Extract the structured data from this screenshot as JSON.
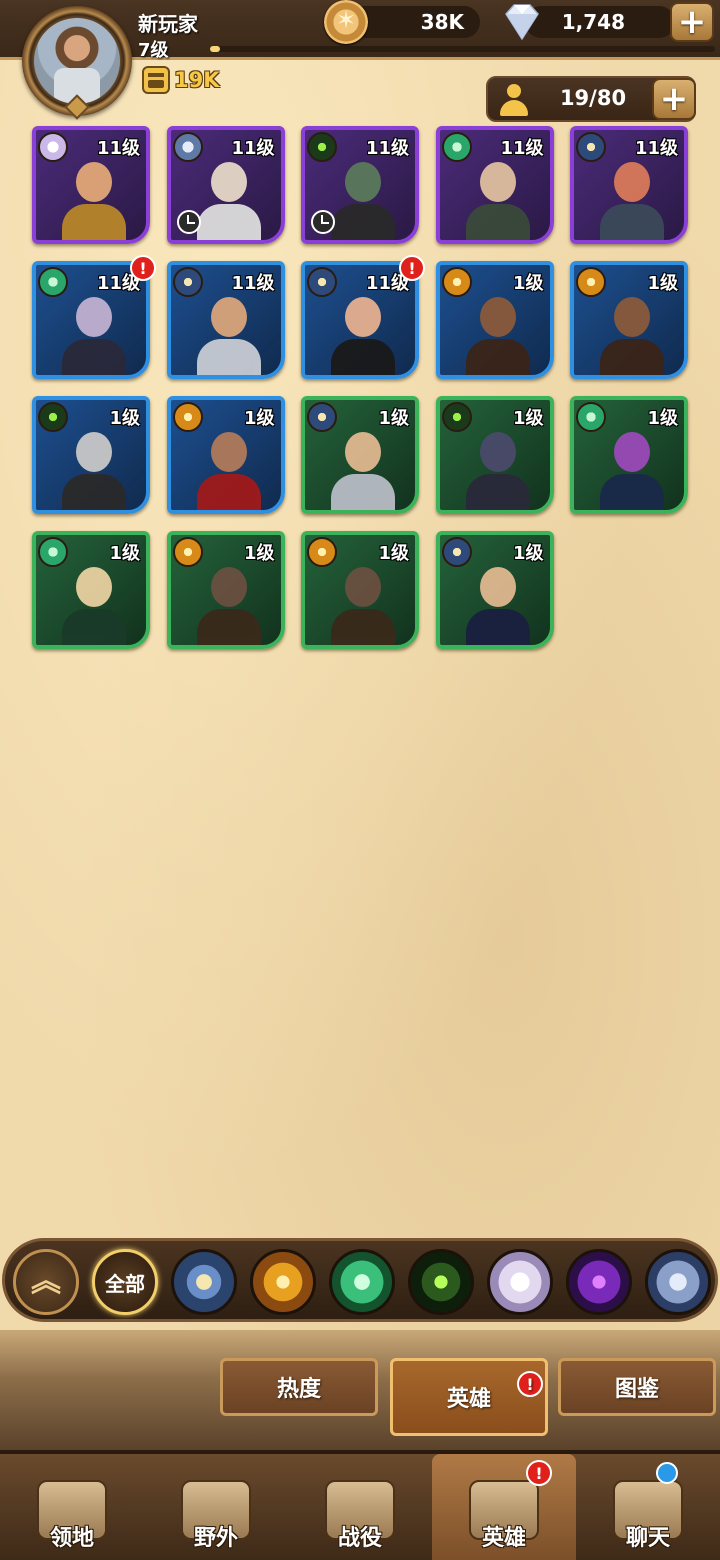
{
  "player": {
    "name": "新玩家",
    "level": "7级",
    "xp_progress": 0.02,
    "power": "19K"
  },
  "currency": {
    "gold": "38K",
    "gems": "1,748",
    "plus": "+"
  },
  "hero_count": {
    "text": "19/80",
    "plus": "+"
  },
  "heroes": [
    {
      "level": "11级",
      "rarity": "purple",
      "faction": "light",
      "clock": false,
      "alert": false
    },
    {
      "level": "11级",
      "rarity": "purple",
      "faction": "mech",
      "clock": true,
      "alert": false
    },
    {
      "level": "11级",
      "rarity": "purple",
      "faction": "eye",
      "clock": true,
      "alert": false
    },
    {
      "level": "11级",
      "rarity": "purple",
      "faction": "leaf",
      "clock": false,
      "alert": false
    },
    {
      "level": "11级",
      "rarity": "purple",
      "faction": "star",
      "clock": false,
      "alert": false
    },
    {
      "level": "11级",
      "rarity": "blue",
      "faction": "leaf",
      "clock": false,
      "alert": true
    },
    {
      "level": "11级",
      "rarity": "blue",
      "faction": "star",
      "clock": false,
      "alert": false
    },
    {
      "level": "11级",
      "rarity": "blue",
      "faction": "star",
      "clock": false,
      "alert": true
    },
    {
      "level": "1级",
      "rarity": "blue",
      "faction": "sun",
      "clock": false,
      "alert": false
    },
    {
      "level": "1级",
      "rarity": "blue",
      "faction": "sun",
      "clock": false,
      "alert": false
    },
    {
      "level": "1级",
      "rarity": "blue",
      "faction": "eye",
      "clock": false,
      "alert": false
    },
    {
      "level": "1级",
      "rarity": "blue",
      "faction": "sun",
      "clock": false,
      "alert": false
    },
    {
      "level": "1级",
      "rarity": "green",
      "faction": "star",
      "clock": false,
      "alert": false
    },
    {
      "level": "1级",
      "rarity": "green",
      "faction": "eye",
      "clock": false,
      "alert": false
    },
    {
      "level": "1级",
      "rarity": "green",
      "faction": "leaf",
      "clock": false,
      "alert": false
    },
    {
      "level": "1级",
      "rarity": "green",
      "faction": "leaf",
      "clock": false,
      "alert": false
    },
    {
      "level": "1级",
      "rarity": "green",
      "faction": "sun",
      "clock": false,
      "alert": false
    },
    {
      "level": "1级",
      "rarity": "green",
      "faction": "sun",
      "clock": false,
      "alert": false
    },
    {
      "level": "1级",
      "rarity": "green",
      "faction": "star",
      "clock": false,
      "alert": false
    }
  ],
  "filters": {
    "all_label": "全部",
    "items": [
      "sort-up",
      "all",
      "star",
      "sun",
      "leaf",
      "eye",
      "light",
      "dark",
      "mech"
    ]
  },
  "subtabs": {
    "heat": "热度",
    "hero": "英雄",
    "guide": "图鉴",
    "alert": "!"
  },
  "nav": {
    "territory": "领地",
    "wild": "野外",
    "campaign": "战役",
    "heroes": "英雄",
    "chat": "聊天",
    "alert": "!"
  },
  "colors": {
    "purple": "#8a3fd6",
    "blue": "#2f8fe0",
    "green": "#3ab35a",
    "alert": "#e0201a",
    "power": "#f6c845"
  }
}
